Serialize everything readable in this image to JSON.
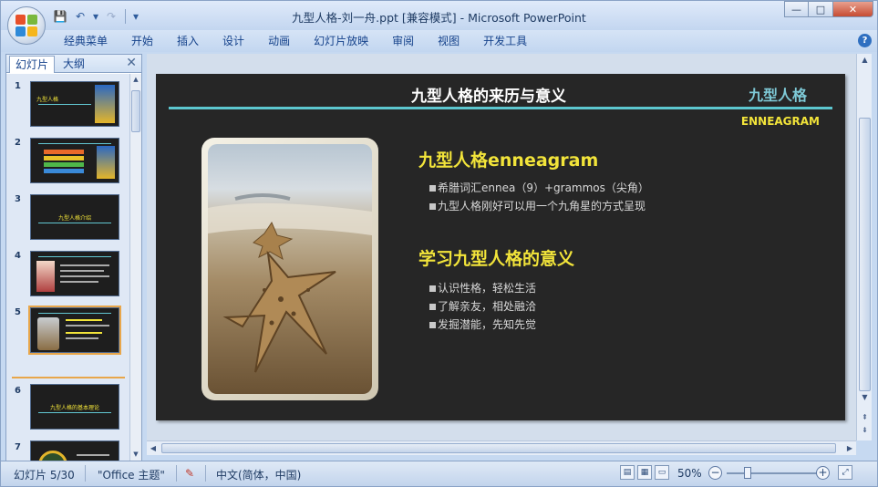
{
  "window": {
    "title": "九型人格-刘一舟.ppt [兼容模式] - Microsoft PowerPoint",
    "minimize": "—",
    "maximize": "□",
    "close": "✕"
  },
  "qat": {
    "save": "💾",
    "undo": "↶",
    "undo_drop": "▾",
    "redo": "↷",
    "customize": "▾"
  },
  "ribbon": {
    "tabs": [
      "经典菜单",
      "开始",
      "插入",
      "设计",
      "动画",
      "幻灯片放映",
      "审阅",
      "视图",
      "开发工具"
    ],
    "help": "?"
  },
  "left_pane": {
    "tabs": {
      "slides": "幻灯片",
      "outline": "大纲"
    },
    "close": "✕",
    "thumbnails": [
      {
        "num": "1",
        "title": "九型人格"
      },
      {
        "num": "2",
        "title": ""
      },
      {
        "num": "3",
        "title": "九型人格介绍"
      },
      {
        "num": "4",
        "title": ""
      },
      {
        "num": "5",
        "title": ""
      },
      {
        "num": "6",
        "title": "九型人格的基本理论"
      },
      {
        "num": "7",
        "title": ""
      }
    ]
  },
  "slide": {
    "title": "九型人格的来历与意义",
    "tag": "九型人格",
    "subtitle": "ENNEAGRAM",
    "section1": {
      "heading": "九型人格enneagram",
      "bullets": [
        "希腊词汇ennea（9）+grammos（尖角）",
        "九型人格刚好可以用一个九角星的方式呈现"
      ]
    },
    "section2": {
      "heading": "学习九型人格的意义",
      "bullets": [
        "认识性格，轻松生活",
        "了解亲友，相处融洽",
        "发掘潜能，先知先觉"
      ]
    }
  },
  "status": {
    "slide_info": "幻灯片 5/30",
    "theme": "\"Office 主题\"",
    "language": "中文(简体，中国)",
    "zoom": "50%"
  },
  "colors": {
    "accent": "#f2e43a",
    "rule": "#5cc6cf",
    "slide_bg": "#262626"
  }
}
